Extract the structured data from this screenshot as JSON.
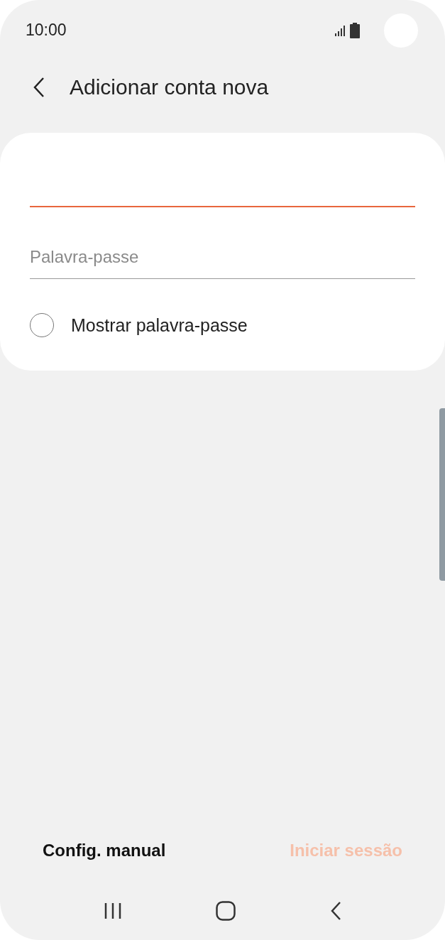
{
  "status_bar": {
    "time": "10:00"
  },
  "header": {
    "title": "Adicionar conta nova"
  },
  "form": {
    "email": {
      "focused": true
    },
    "password": {
      "placeholder": "Palavra-passe"
    },
    "show_password": {
      "label": "Mostrar palavra-passe",
      "checked": false
    }
  },
  "actions": [
    {
      "label": "Config. manual",
      "disabled": false
    },
    {
      "label": "Iniciar sessão",
      "disabled": true
    }
  ]
}
